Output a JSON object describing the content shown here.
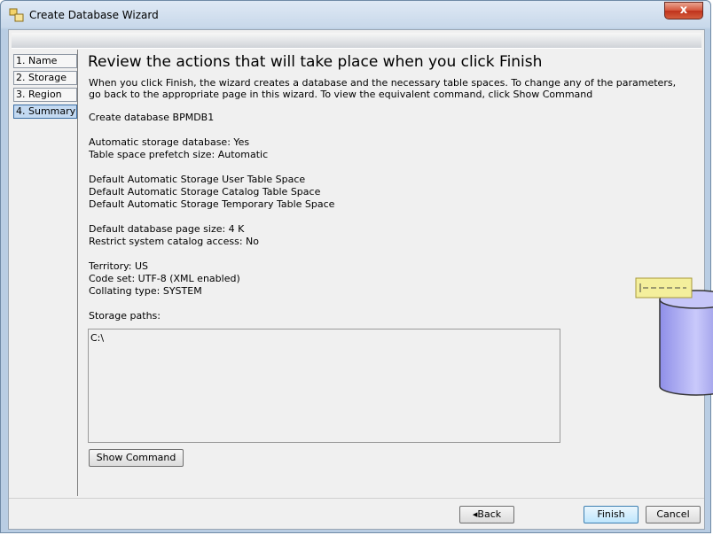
{
  "window": {
    "title": "Create Database Wizard",
    "close_glyph": "x"
  },
  "nav": {
    "items": [
      {
        "label": "1. Name"
      },
      {
        "label": "2. Storage"
      },
      {
        "label": "3. Region"
      },
      {
        "label": "4. Summary",
        "active": true
      }
    ]
  },
  "summary": {
    "heading": "Review the actions that will take place when you click Finish",
    "description": "When you click Finish, the wizard creates a database and the necessary table spaces. To change any of the parameters, go back to the appropriate page in this wizard. To view the equivalent command, click Show Command",
    "lines": [
      "Create database BPMDB1",
      "Automatic storage database: Yes",
      "Table space prefetch size: Automatic",
      "Default Automatic Storage User Table Space",
      "Default Automatic Storage Catalog Table Space",
      "Default Automatic Storage Temporary Table Space",
      "Default database page size: 4 K",
      "Restrict system catalog access: No",
      "Territory: US",
      "Code set: UTF-8 (XML enabled)",
      "Collating type: SYSTEM",
      "Storage paths:"
    ],
    "storage_path_value": "C:\\"
  },
  "buttons": {
    "show_command": "Show Command",
    "back": "Back",
    "finish": "Finish",
    "cancel": "Cancel"
  },
  "colors": {
    "accent": "#3c7fb1",
    "cylinder": "#b9b9f5",
    "note": "#f4ef9c"
  }
}
